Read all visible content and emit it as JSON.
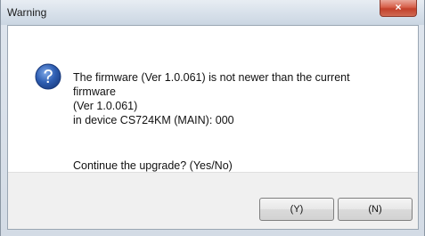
{
  "window": {
    "title": "Warning",
    "close_label": "×"
  },
  "icon": {
    "name": "question-icon",
    "color": "#2f5fb3"
  },
  "message": {
    "lines": [
      "The firmware (Ver 1.0.061) is not newer than the current",
      "firmware",
      "(Ver 1.0.061)",
      "in device CS724KM (MAIN): 000"
    ],
    "prompt": "Continue the upgrade? (Yes/No)"
  },
  "buttons": {
    "yes_label": "(Y)",
    "no_label": "(N)"
  }
}
